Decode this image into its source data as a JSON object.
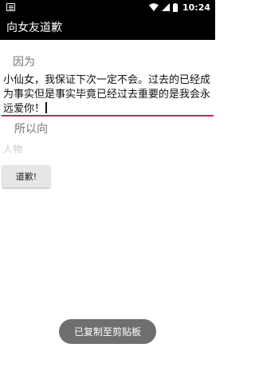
{
  "status_bar": {
    "time": "10:24",
    "icons": [
      "notification-icon",
      "wifi-icon",
      "cellular-signal-icon",
      "battery-icon"
    ]
  },
  "app_bar": {
    "title": "向女友道歉"
  },
  "form": {
    "reason_label": "因为",
    "reason_value": "小仙女，我保证下次一定不会。过去的已经成为事实但是事实毕竟已经过去重要的是我会永远爱你！",
    "target_label": "所以向",
    "person_placeholder": "人物",
    "apology_button_label": "道歉!"
  },
  "toast": {
    "message": "已复制至剪贴板"
  },
  "colors": {
    "accent": "#d81b60",
    "app_bar_background": "#000000",
    "toast_background": "#6f6f6f"
  }
}
